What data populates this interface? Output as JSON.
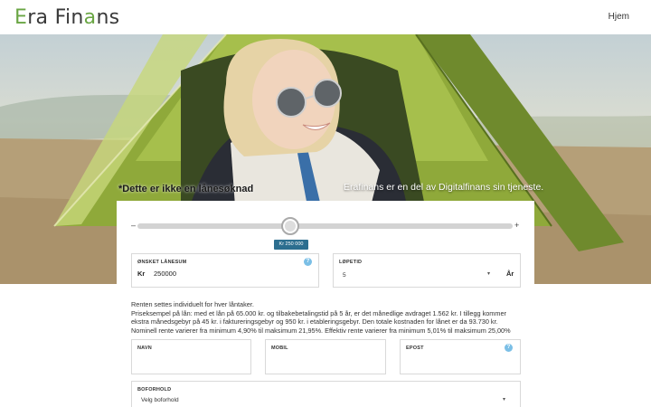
{
  "header": {
    "logo_first": "E",
    "logo_mid": "ra Fin",
    "logo_accent": "a",
    "logo_last": "ns",
    "nav_home": "Hjem"
  },
  "hero": {
    "notice": "*Dette er ikke en lånesøknad",
    "note_right": "Erafinans er en del av Digitalfinans sin tjeneste."
  },
  "loan_form": {
    "slider": {
      "minus": "–",
      "plus": "+",
      "value_label": "Kr 250 000",
      "fraction": 0.4
    },
    "amount": {
      "label": "ØNSKET LÅNESUM",
      "currency": "Kr",
      "value": "250000",
      "help_icon": "question-circle-icon"
    },
    "term": {
      "label": "LØPETID",
      "value": "5",
      "unit": "År",
      "chevron": "▾"
    },
    "info_text": "Renten settes individuelt for hver låntaker.",
    "price_example": "Priseksempel på lån: med et lån på 65.000 kr. og tilbakebetalingstid på 5 år, er det månedlige avdraget 1.562 kr. I tillegg kommer ekstra månedsgebyr på 45 kr. i faktureringsgebyr og 950 kr. i etableringsgebyr. Den totale kostnaden for lånet er da 93.730 kr. Nominell rente varierer fra minimum 4,90% til maksimum 21,95%. Effektiv rente varierer fra minimum 5,01% til maksimum 25,00%",
    "name": {
      "label": "NAVN",
      "value": ""
    },
    "mobil": {
      "label": "MOBIL",
      "value": ""
    },
    "email": {
      "label": "EPOST",
      "value": "",
      "help_icon": "question-circle-icon"
    },
    "housing": {
      "label": "BOFORHOLD",
      "value": "Velg boforhold",
      "chevron": "▾"
    }
  },
  "colors": {
    "logo_accent": "#6aa644",
    "slider_badge": "#2c6e8f",
    "help_icon": "#7bbfe6"
  }
}
